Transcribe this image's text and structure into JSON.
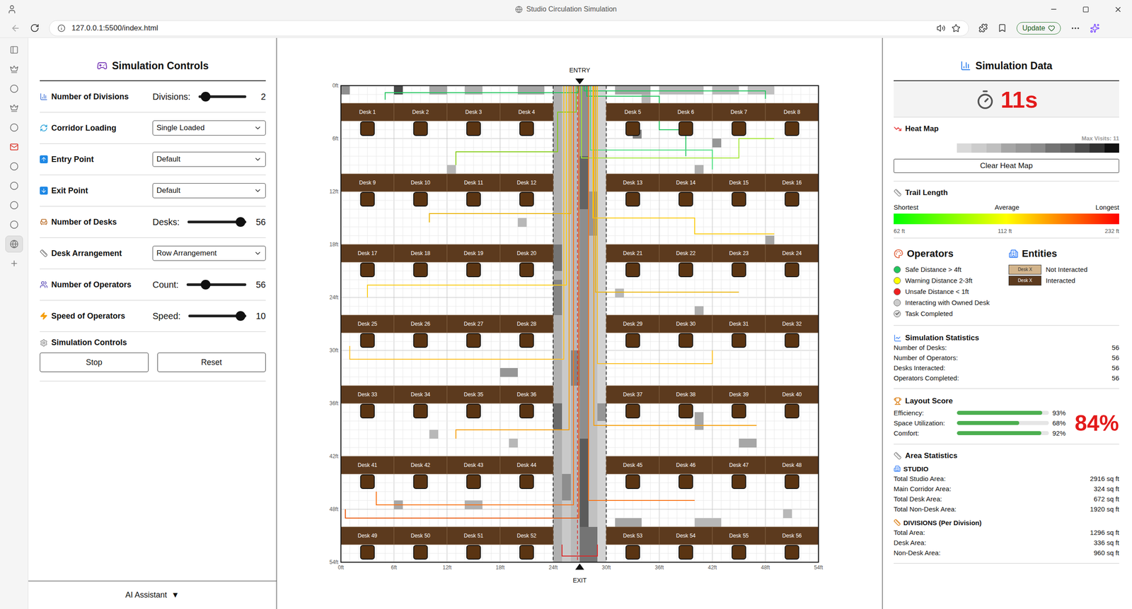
{
  "window": {
    "title": "Studio Circulation Simulation"
  },
  "browser": {
    "url": "127.0.0.1:5500/index.html",
    "update_button": "Update"
  },
  "browser_sidebar": {
    "items": [
      {
        "selected": false
      },
      {
        "selected": false
      },
      {
        "selected": false
      },
      {
        "selected": false
      },
      {
        "selected": false
      },
      {
        "selected": false
      },
      {
        "selected": false
      },
      {
        "selected": false
      },
      {
        "selected": false
      },
      {
        "selected": false
      },
      {
        "selected": true
      },
      {
        "selected": false
      }
    ]
  },
  "controls": {
    "title": "Simulation Controls",
    "rows": [
      {
        "kind": "slider",
        "label": "Number of Divisions",
        "field": "Divisions:",
        "value": "2",
        "level": 0.15
      },
      {
        "kind": "select",
        "label": "Corridor Loading",
        "value": "Single Loaded"
      },
      {
        "kind": "select",
        "label": "Entry Point",
        "value": "Default"
      },
      {
        "kind": "select",
        "label": "Exit Point",
        "value": "Default"
      },
      {
        "kind": "slider",
        "label": "Number of Desks",
        "field": "Desks:",
        "value": "56",
        "level": 0.9
      },
      {
        "kind": "select",
        "label": "Desk Arrangement",
        "value": "Row Arrangement"
      },
      {
        "kind": "slider",
        "label": "Number of Operators",
        "field": "Count:",
        "value": "56",
        "level": 0.32
      },
      {
        "kind": "slider",
        "label": "Speed of Operators",
        "field": "Speed:",
        "value": "10",
        "level": 0.9
      }
    ],
    "section": "Simulation Controls",
    "buttons": [
      "Stop",
      "Reset"
    ],
    "assistant": "AI Assistant",
    "assistant_caret": "▼"
  },
  "plan": {
    "entry": "ENTRY",
    "exit": "EXIT",
    "size_ft": 54,
    "corridor": [
      24,
      30
    ],
    "x_ticks": [
      "0ft",
      "6ft",
      "12ft",
      "18ft",
      "24ft",
      "30ft",
      "36ft",
      "42ft",
      "48ft",
      "54ft"
    ],
    "y_ticks": [
      "0ft",
      "6ft",
      "12ft",
      "18ft",
      "24ft",
      "30ft",
      "36ft",
      "42ft",
      "48ft",
      "54ft"
    ],
    "desks": [
      {
        "label": "Desk 1",
        "interacted": true
      },
      {
        "label": "Desk 2",
        "interacted": true
      },
      {
        "label": "Desk 3",
        "interacted": true
      },
      {
        "label": "Desk 4",
        "interacted": true
      },
      {
        "label": "Desk 5",
        "interacted": true
      },
      {
        "label": "Desk 6",
        "interacted": true
      },
      {
        "label": "Desk 7",
        "interacted": true
      },
      {
        "label": "Desk 8",
        "interacted": true
      },
      {
        "label": "Desk 9",
        "interacted": true
      },
      {
        "label": "Desk 10",
        "interacted": true
      },
      {
        "label": "Desk 11",
        "interacted": true
      },
      {
        "label": "Desk 12",
        "interacted": true
      },
      {
        "label": "Desk 13",
        "interacted": true
      },
      {
        "label": "Desk 14",
        "interacted": true
      },
      {
        "label": "Desk 15",
        "interacted": true
      },
      {
        "label": "Desk 16",
        "interacted": true
      },
      {
        "label": "Desk 17",
        "interacted": true
      },
      {
        "label": "Desk 18",
        "interacted": true
      },
      {
        "label": "Desk 19",
        "interacted": true
      },
      {
        "label": "Desk 20",
        "interacted": true
      },
      {
        "label": "Desk 21",
        "interacted": true
      },
      {
        "label": "Desk 22",
        "interacted": true
      },
      {
        "label": "Desk 23",
        "interacted": true
      },
      {
        "label": "Desk 24",
        "interacted": true
      },
      {
        "label": "Desk 25",
        "interacted": true
      },
      {
        "label": "Desk 26",
        "interacted": true
      },
      {
        "label": "Desk 27",
        "interacted": true
      },
      {
        "label": "Desk 28",
        "interacted": true
      },
      {
        "label": "Desk 29",
        "interacted": true
      },
      {
        "label": "Desk 30",
        "interacted": true
      },
      {
        "label": "Desk 31",
        "interacted": true
      },
      {
        "label": "Desk 32",
        "interacted": true
      },
      {
        "label": "Desk 33",
        "interacted": true
      },
      {
        "label": "Desk 34",
        "interacted": true
      },
      {
        "label": "Desk 35",
        "interacted": true
      },
      {
        "label": "Desk 36",
        "interacted": true
      },
      {
        "label": "Desk 37",
        "interacted": true
      },
      {
        "label": "Desk 38",
        "interacted": true
      },
      {
        "label": "Desk 39",
        "interacted": true
      },
      {
        "label": "Desk 40",
        "interacted": true
      },
      {
        "label": "Desk 41",
        "interacted": true
      },
      {
        "label": "Desk 42",
        "interacted": true
      },
      {
        "label": "Desk 43",
        "interacted": true
      },
      {
        "label": "Desk 44",
        "interacted": true
      },
      {
        "label": "Desk 45",
        "interacted": true
      },
      {
        "label": "Desk 46",
        "interacted": true
      },
      {
        "label": "Desk 47",
        "interacted": true
      },
      {
        "label": "Desk 48",
        "interacted": true
      },
      {
        "label": "Desk 49",
        "interacted": true
      },
      {
        "label": "Desk 50",
        "interacted": true
      },
      {
        "label": "Desk 51",
        "interacted": true
      },
      {
        "label": "Desk 52",
        "interacted": true
      },
      {
        "label": "Desk 53",
        "interacted": true
      },
      {
        "label": "Desk 54",
        "interacted": true
      },
      {
        "label": "Desk 55",
        "interacted": true
      },
      {
        "label": "Desk 56",
        "interacted": true
      }
    ],
    "heat": [
      [
        24,
        0,
        1,
        54,
        0.35
      ],
      [
        25,
        0,
        1,
        54,
        0.2
      ],
      [
        26,
        0,
        1,
        54,
        0.3
      ],
      [
        27,
        0,
        1,
        54,
        0.55
      ],
      [
        28,
        0,
        1,
        54,
        0.25
      ],
      [
        29,
        0,
        1,
        54,
        0.15
      ],
      [
        24,
        18,
        1,
        3,
        0.7
      ],
      [
        24,
        22,
        1,
        4,
        0.6
      ],
      [
        24,
        36,
        1,
        3,
        0.75
      ],
      [
        27,
        8,
        1,
        6,
        0.8
      ],
      [
        27,
        40,
        1,
        10,
        0.85
      ],
      [
        27,
        50,
        2,
        4,
        0.7
      ],
      [
        26,
        30,
        1,
        4,
        0.6
      ],
      [
        28,
        12,
        1,
        5,
        0.5
      ],
      [
        25,
        44,
        1,
        3,
        0.55
      ],
      [
        29,
        36,
        1,
        2,
        0.5
      ],
      [
        0,
        0,
        1,
        1,
        0.55
      ],
      [
        6,
        0,
        1,
        1,
        0.95
      ],
      [
        10,
        0,
        2,
        1,
        0.4
      ],
      [
        14,
        0,
        2,
        1,
        0.35
      ],
      [
        20,
        0,
        3,
        1,
        0.4
      ],
      [
        31,
        0,
        4,
        1,
        0.4
      ],
      [
        36,
        0,
        5,
        1,
        0.3
      ],
      [
        42,
        0,
        3,
        1,
        0.3
      ],
      [
        46,
        0,
        3,
        1,
        0.25
      ],
      [
        34,
        1,
        1,
        1,
        0.3
      ],
      [
        33,
        5,
        1,
        1,
        0.6
      ],
      [
        42,
        6,
        1,
        1,
        0.5
      ],
      [
        12,
        9,
        1,
        1,
        0.3
      ],
      [
        40,
        9,
        1,
        1,
        0.35
      ],
      [
        20,
        15,
        1,
        1,
        0.3
      ],
      [
        48,
        17,
        1,
        1,
        0.4
      ],
      [
        31,
        23,
        1,
        1,
        0.3
      ],
      [
        40,
        25,
        1,
        1,
        0.35
      ],
      [
        18,
        32,
        2,
        1,
        0.5
      ],
      [
        40,
        37,
        1,
        2,
        0.4
      ],
      [
        45,
        40,
        2,
        1,
        0.4
      ],
      [
        6,
        47,
        1,
        1,
        0.4
      ],
      [
        14,
        47,
        2,
        1,
        0.35
      ],
      [
        31,
        49,
        3,
        1,
        0.4
      ],
      [
        40,
        49,
        3,
        1,
        0.3
      ],
      [
        50,
        48,
        1,
        1,
        0.3
      ],
      [
        10,
        39,
        1,
        1,
        0.3
      ],
      [
        19,
        40,
        1,
        1,
        0.3
      ],
      [
        37,
        27,
        1,
        1,
        0.3
      ]
    ],
    "trails": [
      {
        "color": "#22c55e",
        "points": [
          [
            27.5,
            0
          ],
          [
            27.5,
            0.6
          ],
          [
            48,
            0.6
          ],
          [
            48,
            1.5
          ]
        ]
      },
      {
        "color": "#22c55e",
        "points": [
          [
            27.8,
            0
          ],
          [
            27.8,
            1.2
          ],
          [
            36,
            1.2
          ],
          [
            36,
            5
          ],
          [
            39,
            5
          ],
          [
            39,
            8
          ]
        ]
      },
      {
        "color": "#4ade80",
        "points": [
          [
            28.2,
            0
          ],
          [
            28.2,
            7.3
          ],
          [
            42,
            7.3
          ],
          [
            42,
            9.5
          ]
        ]
      },
      {
        "color": "#84cc16",
        "points": [
          [
            26.6,
            0
          ],
          [
            26.6,
            3
          ],
          [
            24.5,
            3
          ],
          [
            24.5,
            7.5
          ],
          [
            13,
            7.5
          ],
          [
            13,
            9
          ]
        ]
      },
      {
        "color": "#a3e635",
        "points": [
          [
            27.2,
            0
          ],
          [
            27.2,
            8.2
          ],
          [
            45,
            8.2
          ],
          [
            45,
            6
          ],
          [
            49,
            6
          ]
        ]
      },
      {
        "color": "#22c55e",
        "points": [
          [
            26.8,
            0
          ],
          [
            26.8,
            0.8
          ],
          [
            5,
            0.8
          ],
          [
            5,
            1.6
          ]
        ]
      },
      {
        "color": "#eab308",
        "points": [
          [
            26,
            0
          ],
          [
            26,
            14.5
          ],
          [
            10,
            14.5
          ],
          [
            10,
            15.5
          ]
        ]
      },
      {
        "color": "#facc15",
        "points": [
          [
            28.5,
            0
          ],
          [
            28.5,
            15
          ],
          [
            40,
            15
          ],
          [
            40,
            16.8
          ],
          [
            49,
            16.8
          ]
        ]
      },
      {
        "color": "#facc15",
        "points": [
          [
            25.5,
            0
          ],
          [
            25.5,
            22.6
          ],
          [
            3,
            22.6
          ],
          [
            3,
            24
          ]
        ]
      },
      {
        "color": "#eab308",
        "points": [
          [
            28.8,
            0
          ],
          [
            28.8,
            23.4
          ],
          [
            45,
            23.4
          ]
        ]
      },
      {
        "color": "#fbbf24",
        "points": [
          [
            25.2,
            0
          ],
          [
            25.2,
            31
          ],
          [
            1,
            31
          ],
          [
            1,
            29.5
          ]
        ]
      },
      {
        "color": "#fbbf24",
        "points": [
          [
            29,
            0
          ],
          [
            29,
            31.5
          ],
          [
            42,
            31.5
          ],
          [
            42,
            30
          ]
        ]
      },
      {
        "color": "#f59e0b",
        "points": [
          [
            25.8,
            0
          ],
          [
            25.8,
            39
          ],
          [
            13,
            39
          ],
          [
            13,
            40
          ]
        ]
      },
      {
        "color": "#f59e0b",
        "points": [
          [
            28.6,
            0
          ],
          [
            28.6,
            38.5
          ],
          [
            47,
            38.5
          ]
        ]
      },
      {
        "color": "#f97316",
        "points": [
          [
            26.3,
            0
          ],
          [
            26.3,
            47.5
          ],
          [
            4,
            47.5
          ],
          [
            4,
            46
          ]
        ]
      },
      {
        "color": "#ea580c",
        "points": [
          [
            26.9,
            0
          ],
          [
            26.9,
            49
          ],
          [
            0.5,
            49
          ],
          [
            0.5,
            48
          ]
        ]
      },
      {
        "color": "#f97316",
        "points": [
          [
            28,
            0
          ],
          [
            28,
            47
          ],
          [
            40,
            47
          ]
        ]
      },
      {
        "color": "#dc2626",
        "points": [
          [
            25,
            52
          ],
          [
            25,
            53.3
          ],
          [
            29,
            53.3
          ],
          [
            29,
            52
          ]
        ]
      }
    ]
  },
  "stats_panel": {
    "title": "Simulation Data",
    "timer": "11s",
    "heat_map": {
      "title": "Heat Map",
      "max_label": "Max Visits: 11",
      "scale": [
        "#d9d9d9",
        "#cccccc",
        "#bfbfbf",
        "#a6a6a6",
        "#999999",
        "#8c8c8c",
        "#737373",
        "#666666",
        "#4d4d4d",
        "#333333",
        "#111111"
      ],
      "button": "Clear Heat Map"
    },
    "trail_length": {
      "title": "Trail Length",
      "labels": [
        "Shortest",
        "Average",
        "Longest"
      ],
      "values": [
        "62 ft",
        "112 ft",
        "232 ft"
      ]
    },
    "operators": {
      "title": "Operators",
      "items": [
        {
          "kind": "dot",
          "label": "Safe Distance > 4ft",
          "color": "#22c55e"
        },
        {
          "kind": "dot",
          "label": "Warning Distance 2-3ft",
          "color": "#ffff00"
        },
        {
          "kind": "dot",
          "label": "Unsafe Distance < 1ft",
          "color": "#ef2020"
        },
        {
          "kind": "dot",
          "label": "Interacting with Owned Desk",
          "color": "#cccccc"
        },
        {
          "kind": "check",
          "label": "Task Completed",
          "color": "#dddddd"
        }
      ]
    },
    "entities": {
      "title": "Entities",
      "items": [
        {
          "badge": "Desk X",
          "label": "Not Interacted",
          "interacted": false
        },
        {
          "badge": "Desk X",
          "label": "Interacted",
          "interacted": true
        }
      ]
    },
    "simulation_statistics": {
      "title": "Simulation Statistics",
      "rows": [
        {
          "label": "Number of Desks:",
          "value": "56"
        },
        {
          "label": "Number of Operators:",
          "value": "56"
        },
        {
          "label": "Desks Interacted:",
          "value": "56"
        },
        {
          "label": "Operators Completed:",
          "value": "56"
        }
      ]
    },
    "layout_score": {
      "title": "Layout Score",
      "total": "84%",
      "metrics": [
        {
          "label": "Efficiency:",
          "value": "93%",
          "level": 0.93
        },
        {
          "label": "Space Utilization:",
          "value": "68%",
          "level": 0.68
        },
        {
          "label": "Comfort:",
          "value": "92%",
          "level": 0.92
        }
      ]
    },
    "area": {
      "title": "Area Statistics",
      "groups": [
        {
          "title": "STUDIO",
          "rows": [
            {
              "label": "Total Studio Area:",
              "value": "2916 sq ft"
            },
            {
              "label": "Main Corridor Area:",
              "value": "324 sq ft"
            },
            {
              "label": "Total Desk Area:",
              "value": "672 sq ft"
            },
            {
              "label": "Total Non-Desk Area:",
              "value": "1920 sq ft"
            }
          ]
        },
        {
          "title": "DIVISIONS (Per Division)",
          "rows": [
            {
              "label": "Total Area:",
              "value": "1296 sq ft"
            },
            {
              "label": "Desk Area:",
              "value": "336 sq ft"
            },
            {
              "label": "Non-Desk Area:",
              "value": "960 sq ft"
            }
          ]
        }
      ]
    }
  }
}
